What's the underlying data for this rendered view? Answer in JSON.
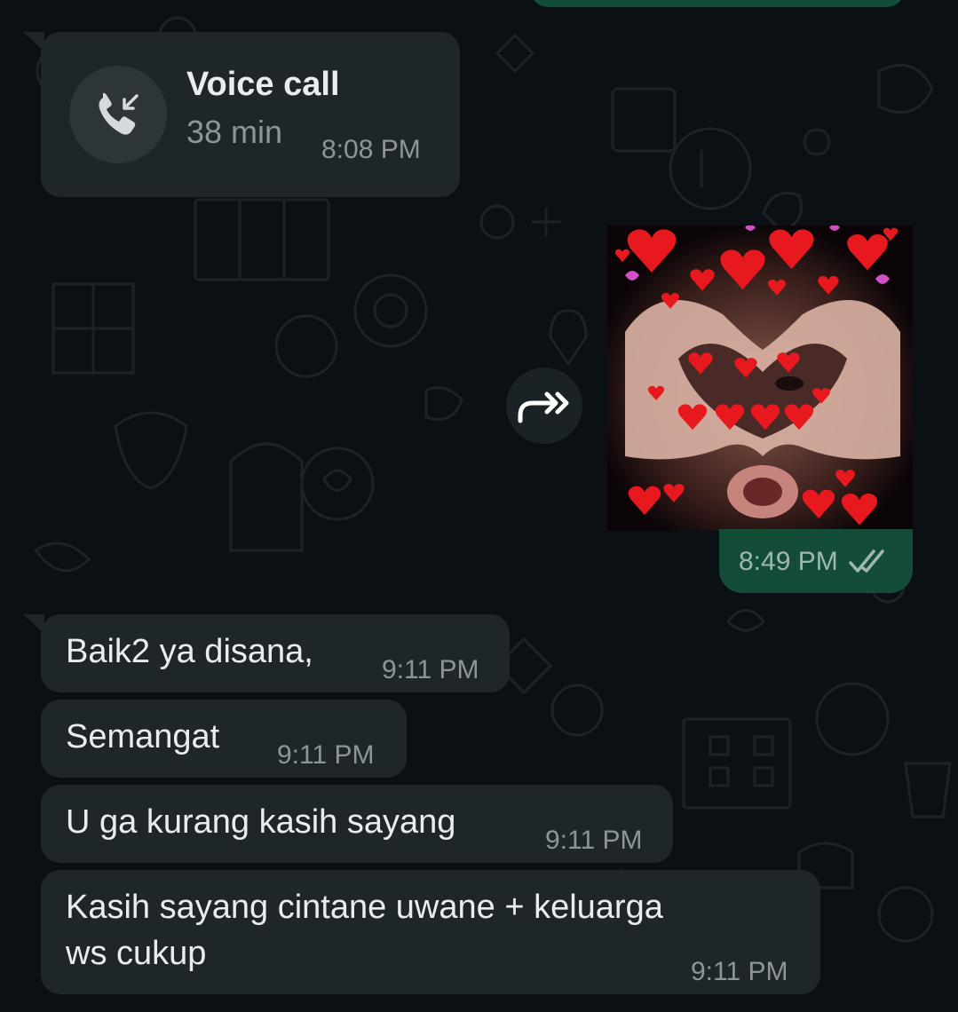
{
  "call": {
    "title": "Voice call",
    "duration": "38 min",
    "time": "8:08 PM",
    "icon": "incoming-call-icon"
  },
  "sent_image": {
    "time": "8:49 PM",
    "status": "read",
    "forward_icon": "forward-icon",
    "image": "heart-hands-with-hearts-photo"
  },
  "messages": [
    {
      "text": "Baik2 ya disana,",
      "time": "9:11 PM"
    },
    {
      "text": "Semangat",
      "time": "9:11 PM"
    },
    {
      "text": "U ga kurang kasih sayang",
      "time": "9:11 PM"
    },
    {
      "lines": [
        "Kasih sayang cintane uwane + keluarga",
        "ws cukup"
      ],
      "time": "9:11 PM"
    }
  ],
  "colors": {
    "background": "#0b1014",
    "incoming_bubble": "#1f2629",
    "outgoing_bubble": "#144d37",
    "read_ticks": "#53bdeb",
    "meta_text": "#8d9599"
  }
}
